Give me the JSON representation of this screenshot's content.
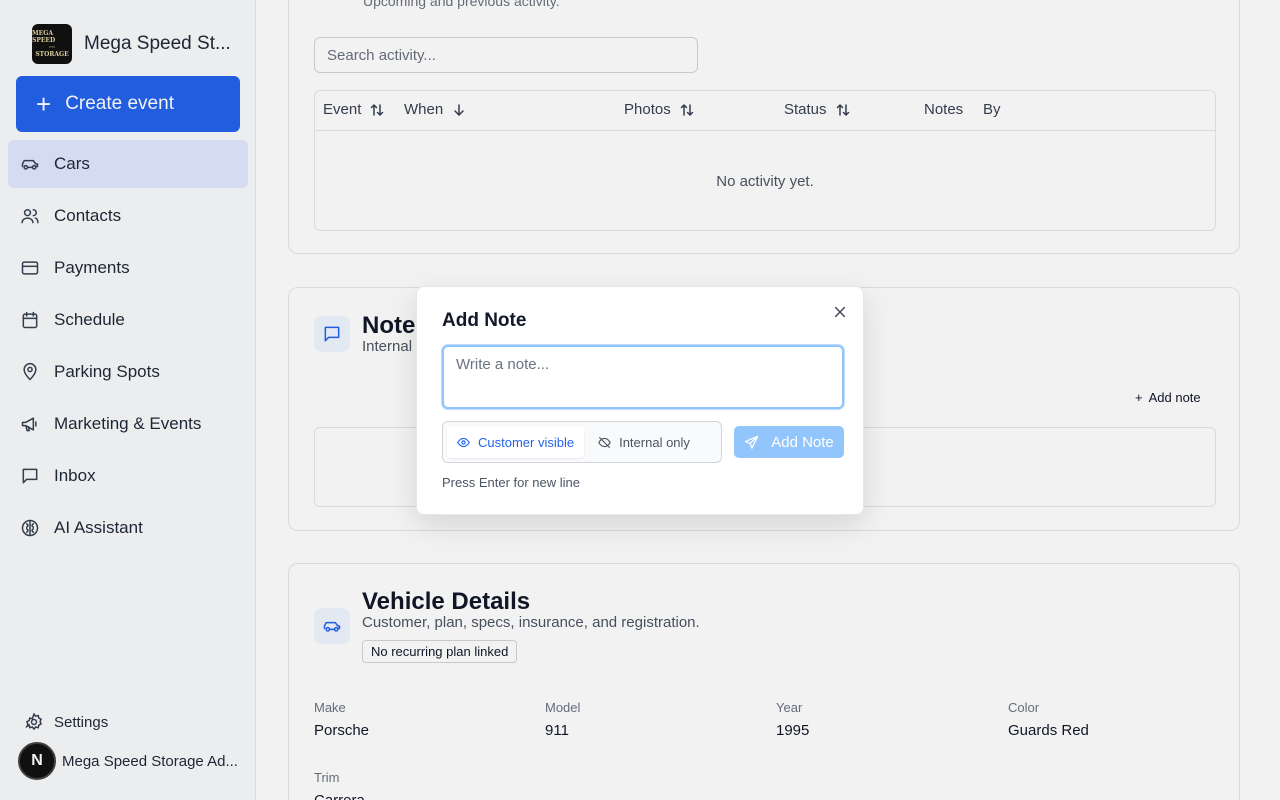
{
  "app": {
    "brand_name": "Mega Speed St...",
    "logo_lines": [
      "MEGA SPEED",
      "···",
      "STORAGE"
    ],
    "create_event": "Create event",
    "accent": "#2563eb"
  },
  "sidebar": {
    "items": [
      {
        "label": "Cars",
        "icon": "car-icon",
        "active": true
      },
      {
        "label": "Contacts",
        "icon": "users-icon"
      },
      {
        "label": "Payments",
        "icon": "credit-card-icon"
      },
      {
        "label": "Schedule",
        "icon": "calendar-icon"
      },
      {
        "label": "Parking Spots",
        "icon": "map-pin-icon"
      },
      {
        "label": "Marketing & Events",
        "icon": "megaphone-icon"
      },
      {
        "label": "Inbox",
        "icon": "message-square-icon"
      },
      {
        "label": "AI Assistant",
        "icon": "brain-icon"
      }
    ],
    "settings": "Settings",
    "user_name": "Mega Speed Storage Ad...",
    "user_initial": "N"
  },
  "activity": {
    "subtitle": "Upcoming and previous activity.",
    "search_placeholder": "Search activity...",
    "columns": [
      "Event",
      "When",
      "Photos",
      "Status",
      "Notes",
      "By"
    ],
    "empty": "No activity yet."
  },
  "notes": {
    "title": "Note",
    "subtitle": "Internal",
    "add_note": "Add note"
  },
  "vehicle": {
    "title": "Vehicle Details",
    "subtitle": "Customer, plan, specs, insurance, and registration.",
    "badge": "No recurring plan linked",
    "fields": [
      {
        "label": "Make",
        "value": "Porsche"
      },
      {
        "label": "Model",
        "value": "911"
      },
      {
        "label": "Year",
        "value": "1995"
      },
      {
        "label": "Color",
        "value": "Guards Red"
      },
      {
        "label": "Trim",
        "value": "Carrera"
      }
    ]
  },
  "modal": {
    "title": "Add Note",
    "placeholder": "Write a note...",
    "customer_visible": "Customer visible",
    "internal_only": "Internal only",
    "submit": "Add Note",
    "hint": "Press Enter for new line"
  }
}
